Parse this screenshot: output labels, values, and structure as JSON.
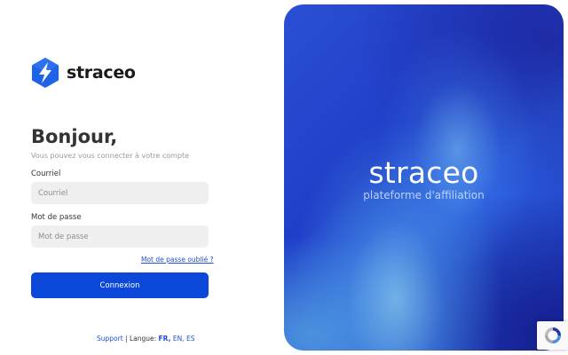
{
  "brand": {
    "name": "straceo",
    "logo_icon": "lightning-hexagon-icon",
    "color": "#1f63e6"
  },
  "login": {
    "greeting": "Bonjour,",
    "subtitle": "Vous pouvez vous connecter à votre compte",
    "email_label": "Courriel",
    "email_placeholder": "Courriel",
    "email_value": "",
    "password_label": "Mot de passe",
    "password_placeholder": "Mot de passe",
    "password_value": "",
    "forgot_label": "Mot de passe oublié ?",
    "submit_label": "Connexion",
    "accent_color": "#0b47d9"
  },
  "footer": {
    "support_label": "Support",
    "separator": "|",
    "language_prefix": "Langue:",
    "languages": [
      "FR,",
      "EN,",
      "ES"
    ],
    "active_language": "FR"
  },
  "panel": {
    "title": "straceo",
    "subtitle": "plateforme d'affiliation"
  },
  "recaptcha": {
    "icon": "recaptcha-icon"
  }
}
